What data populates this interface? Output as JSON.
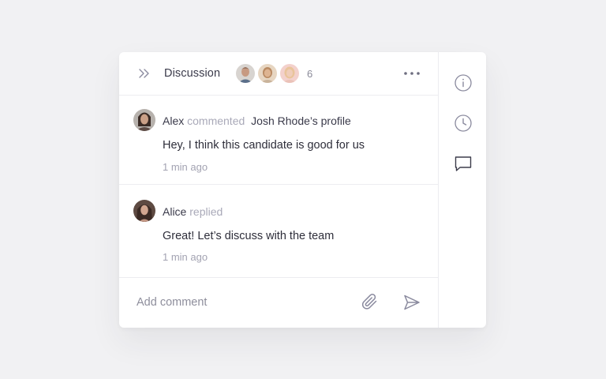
{
  "header": {
    "title": "Discussion",
    "participant_count": "6",
    "collapse_icon": "chevrons-right-icon",
    "more_icon": "more-horizontal-icon"
  },
  "comments": [
    {
      "author": "Alex",
      "verb": "commented",
      "target": "Josh Rhode’s profile",
      "body": "Hey, I think this candidate is good for us",
      "time": "1 min ago"
    },
    {
      "author": "Alice",
      "verb": "replied",
      "body": "Great! Let’s discuss with the team",
      "time": "1 min ago"
    }
  ],
  "composer": {
    "placeholder": "Add comment",
    "attach_icon": "paperclip-icon",
    "send_icon": "send-icon"
  },
  "rail": {
    "icons": [
      "info-icon",
      "clock-icon",
      "message-square-icon"
    ]
  },
  "colors": {
    "background": "#f1f1f3",
    "card": "#ffffff",
    "text_primary": "#3a3a4a",
    "text_muted": "#a9a9b8",
    "divider": "#ececf0",
    "icon": "#8a8a9e"
  }
}
